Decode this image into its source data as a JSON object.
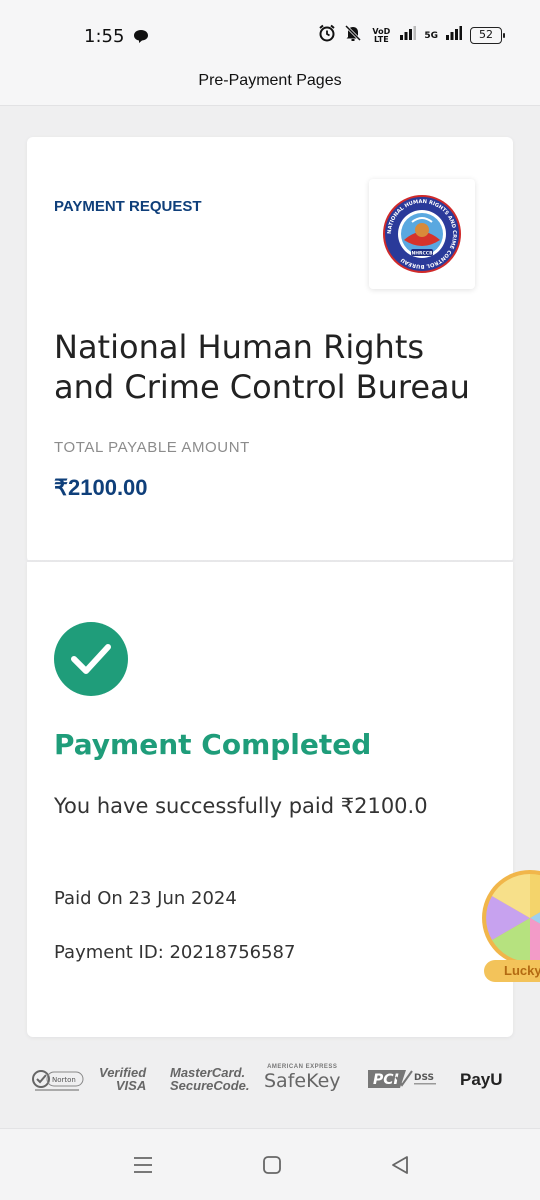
{
  "status_bar": {
    "time": "1:55",
    "volte_label": "VoD LTE",
    "network_label": "5G",
    "battery": "52",
    "icons": [
      "message-icon",
      "alarm-icon",
      "mute-icon",
      "signal-icon",
      "signal-icon",
      "battery-icon"
    ]
  },
  "header": {
    "title": "Pre-Payment Pages"
  },
  "request": {
    "label": "PAYMENT REQUEST",
    "org_name": "National Human Rights and Crime Control Bureau",
    "amount_label": "TOTAL PAYABLE AMOUNT",
    "amount": "₹2100.00",
    "logo_ring_text": "NATIONAL HUMAN RIGHTS AND CRIME CONTROL BUREAU",
    "logo_badge_text": "NHRCCB"
  },
  "result": {
    "title": "Payment Completed",
    "message": "You have successfully paid ₹2100.0",
    "paid_on": "Paid On 23 Jun 2024",
    "payment_id": "Payment ID: 20218756587",
    "accent_color": "#1f9d7a"
  },
  "lucky_widget": {
    "label": "Lucky"
  },
  "trust_badges": {
    "norton": "Norton",
    "visa_line1": "Verified",
    "visa_line2": "VISA",
    "mc_line1": "MasterCard.",
    "mc_line2": "SecureCode.",
    "amex_small": "AMERICAN EXPRESS",
    "amex_big": "SafeKey",
    "pci": "PCI",
    "dss": "DSS",
    "payu": "PayU"
  },
  "nav": {
    "icons": [
      "recents-icon",
      "home-icon",
      "back-icon"
    ]
  }
}
